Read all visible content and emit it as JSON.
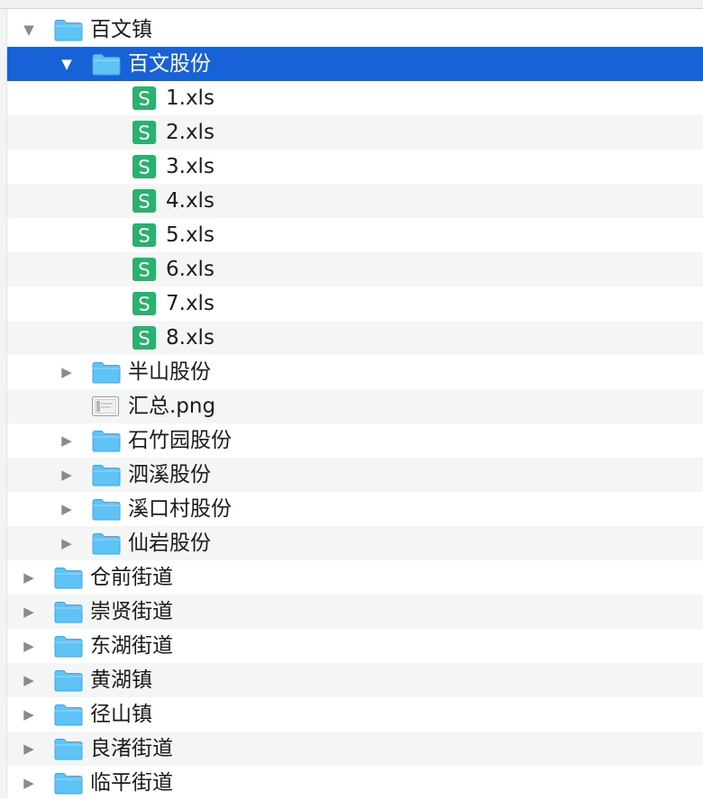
{
  "tree": {
    "rows": [
      {
        "label": "百文镇",
        "type": "folder",
        "depth": 0,
        "disclosure": "expanded",
        "selected": false,
        "alt": false
      },
      {
        "label": "百文股份",
        "type": "folder",
        "depth": 1,
        "disclosure": "expanded",
        "selected": true,
        "alt": false
      },
      {
        "label": "1.xls",
        "type": "spreadsheet",
        "depth": 2,
        "disclosure": "none",
        "selected": false,
        "alt": false
      },
      {
        "label": "2.xls",
        "type": "spreadsheet",
        "depth": 2,
        "disclosure": "none",
        "selected": false,
        "alt": true
      },
      {
        "label": "3.xls",
        "type": "spreadsheet",
        "depth": 2,
        "disclosure": "none",
        "selected": false,
        "alt": false
      },
      {
        "label": "4.xls",
        "type": "spreadsheet",
        "depth": 2,
        "disclosure": "none",
        "selected": false,
        "alt": true
      },
      {
        "label": "5.xls",
        "type": "spreadsheet",
        "depth": 2,
        "disclosure": "none",
        "selected": false,
        "alt": false
      },
      {
        "label": "6.xls",
        "type": "spreadsheet",
        "depth": 2,
        "disclosure": "none",
        "selected": false,
        "alt": true
      },
      {
        "label": "7.xls",
        "type": "spreadsheet",
        "depth": 2,
        "disclosure": "none",
        "selected": false,
        "alt": false
      },
      {
        "label": "8.xls",
        "type": "spreadsheet",
        "depth": 2,
        "disclosure": "none",
        "selected": false,
        "alt": true
      },
      {
        "label": "半山股份",
        "type": "folder",
        "depth": 1,
        "disclosure": "collapsed",
        "selected": false,
        "alt": false
      },
      {
        "label": "汇总.png",
        "type": "image",
        "depth": 1,
        "disclosure": "none",
        "selected": false,
        "alt": true
      },
      {
        "label": "石竹园股份",
        "type": "folder",
        "depth": 1,
        "disclosure": "collapsed",
        "selected": false,
        "alt": false
      },
      {
        "label": "泗溪股份",
        "type": "folder",
        "depth": 1,
        "disclosure": "collapsed",
        "selected": false,
        "alt": true
      },
      {
        "label": "溪口村股份",
        "type": "folder",
        "depth": 1,
        "disclosure": "collapsed",
        "selected": false,
        "alt": false
      },
      {
        "label": "仙岩股份",
        "type": "folder",
        "depth": 1,
        "disclosure": "collapsed",
        "selected": false,
        "alt": true
      },
      {
        "label": "仓前街道",
        "type": "folder",
        "depth": 0,
        "disclosure": "collapsed",
        "selected": false,
        "alt": false
      },
      {
        "label": "崇贤街道",
        "type": "folder",
        "depth": 0,
        "disclosure": "collapsed",
        "selected": false,
        "alt": true
      },
      {
        "label": "东湖街道",
        "type": "folder",
        "depth": 0,
        "disclosure": "collapsed",
        "selected": false,
        "alt": false
      },
      {
        "label": "黄湖镇",
        "type": "folder",
        "depth": 0,
        "disclosure": "collapsed",
        "selected": false,
        "alt": true
      },
      {
        "label": "径山镇",
        "type": "folder",
        "depth": 0,
        "disclosure": "collapsed",
        "selected": false,
        "alt": false
      },
      {
        "label": "良渚街道",
        "type": "folder",
        "depth": 0,
        "disclosure": "collapsed",
        "selected": false,
        "alt": true
      },
      {
        "label": "临平街道",
        "type": "folder",
        "depth": 0,
        "disclosure": "collapsed",
        "selected": false,
        "alt": false
      }
    ]
  },
  "icons": {
    "folder": "folder-icon",
    "spreadsheet": "spreadsheet-icon",
    "image": "image-file-icon",
    "expanded": "disclosure-triangle-down-icon",
    "collapsed": "disclosure-triangle-right-icon"
  },
  "colors": {
    "selection": "#1762d6",
    "folder": "#5fc3f6",
    "spreadsheet": "#27b36e",
    "alternate_row": "#f4f5f5"
  }
}
